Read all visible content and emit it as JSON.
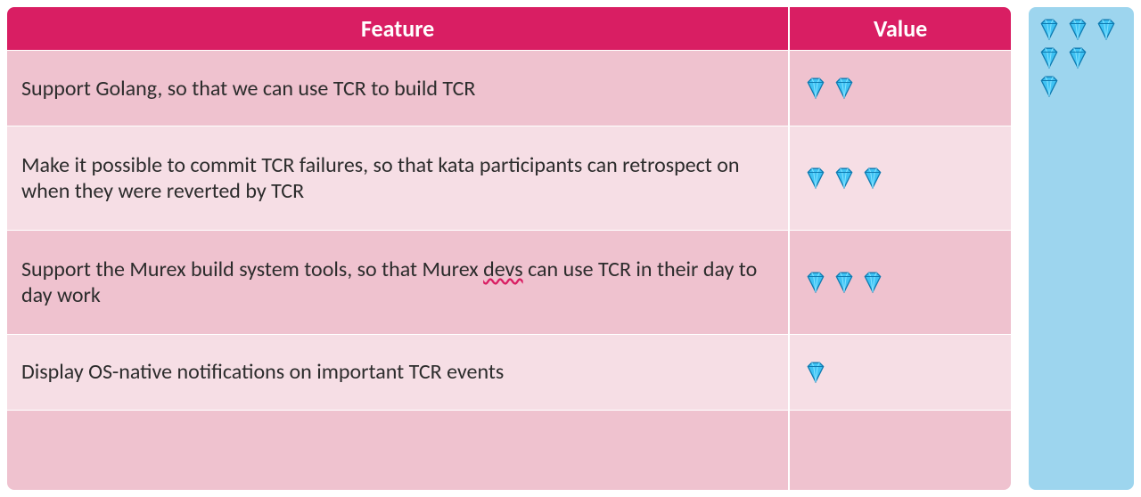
{
  "header": {
    "feature": "Feature",
    "value": "Value"
  },
  "rows": [
    {
      "feature_html": "Support Golang, so that we can use TCR to build TCR",
      "gems": 2
    },
    {
      "feature_html": "Make it possible to commit TCR failures, so that kata participants can retrospect on when they were reverted by TCR",
      "gems": 3
    },
    {
      "feature_html": "Support the Murex build system tools, so that Murex <span class=\"spell-squiggle\">devs</span> can use TCR in their day to day work",
      "gems": 3
    },
    {
      "feature_html": "Display OS-native notifications on important TCR events",
      "gems": 1
    },
    {
      "feature_html": "",
      "gems": 0
    }
  ],
  "side_gems": [
    3,
    2,
    1
  ],
  "icon_names": {
    "diamond": "diamond-icon"
  }
}
